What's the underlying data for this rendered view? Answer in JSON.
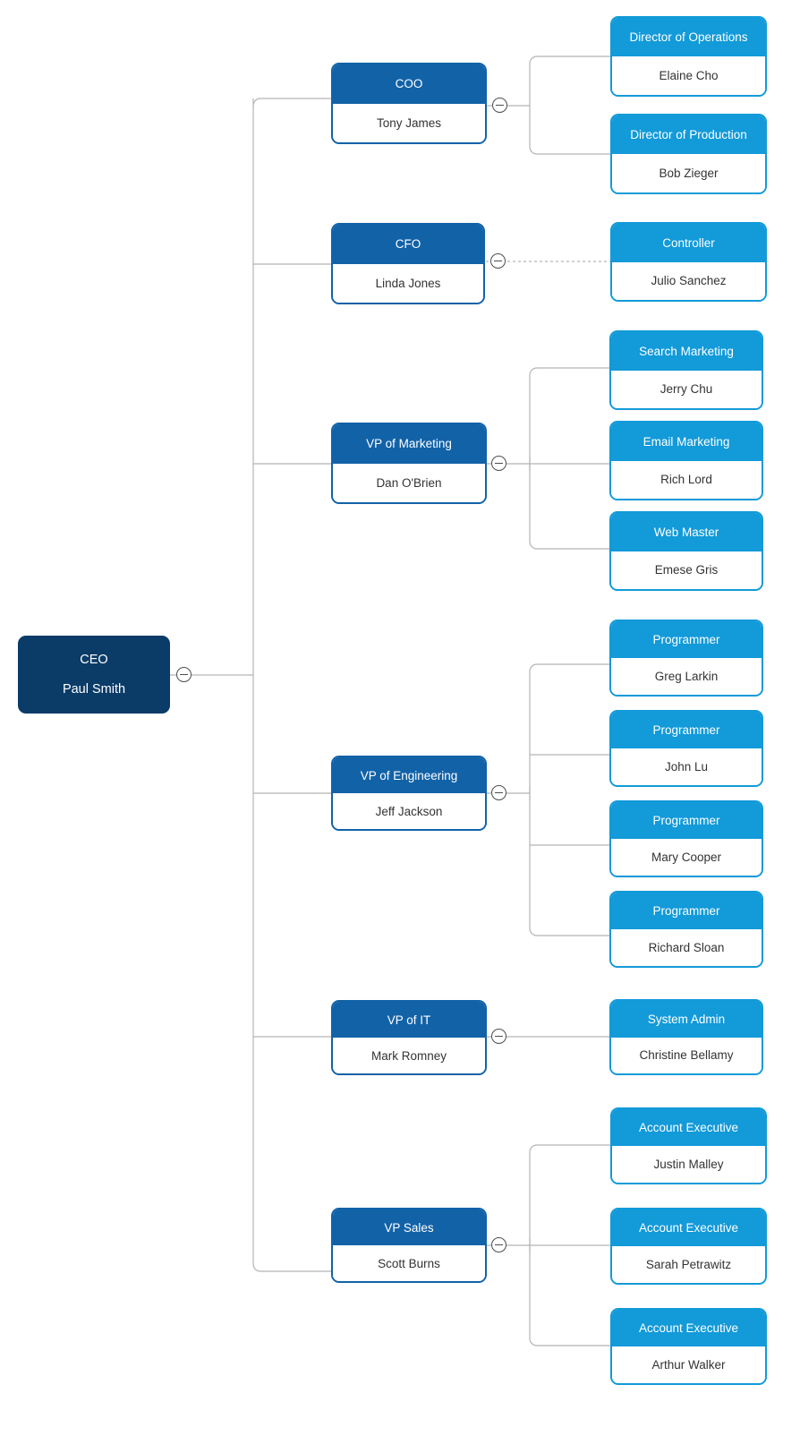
{
  "chart": {
    "type": "org-chart",
    "orientation": "horizontal-left-to-right",
    "colors": {
      "root_fill": "#0b3c68",
      "level2_fill": "#1262a8",
      "level3_fill": "#129ad9",
      "connector": "#b3b3b3",
      "node_body": "#ffffff",
      "name_text": "#333333",
      "title_text": "#ffffff"
    },
    "toggle_icon": "minus-circle-icon"
  },
  "nodes": {
    "ceo": {
      "title": "CEO",
      "name": "Paul Smith"
    },
    "coo": {
      "title": "COO",
      "name": "Tony James"
    },
    "cfo": {
      "title": "CFO",
      "name": "Linda Jones"
    },
    "vp_marketing": {
      "title": "VP of Marketing",
      "name": "Dan O'Brien"
    },
    "vp_engineering": {
      "title": "VP of Engineering",
      "name": "Jeff Jackson"
    },
    "vp_it": {
      "title": "VP of IT",
      "name": "Mark Romney"
    },
    "vp_sales": {
      "title": "VP Sales",
      "name": "Scott Burns"
    },
    "dir_operations": {
      "title": "Director of Operations",
      "name": "Elaine Cho"
    },
    "dir_production": {
      "title": "Director of Production",
      "name": "Bob Zieger"
    },
    "controller": {
      "title": "Controller",
      "name": "Julio Sanchez"
    },
    "search_marketing": {
      "title": "Search Marketing",
      "name": "Jerry Chu"
    },
    "email_marketing": {
      "title": "Email Marketing",
      "name": "Rich Lord"
    },
    "web_master": {
      "title": "Web Master",
      "name": "Emese Gris"
    },
    "programmer_1": {
      "title": "Programmer",
      "name": "Greg Larkin"
    },
    "programmer_2": {
      "title": "Programmer",
      "name": "John Lu"
    },
    "programmer_3": {
      "title": "Programmer",
      "name": "Mary Cooper"
    },
    "programmer_4": {
      "title": "Programmer",
      "name": "Richard Sloan"
    },
    "system_admin": {
      "title": "System Admin",
      "name": "Christine Bellamy"
    },
    "account_exec_1": {
      "title": "Account Executive",
      "name": "Justin Malley"
    },
    "account_exec_2": {
      "title": "Account Executive",
      "name": "Sarah Petrawitz"
    },
    "account_exec_3": {
      "title": "Account Executive",
      "name": "Arthur Walker"
    }
  },
  "chart_data": {
    "type": "tree",
    "root": "ceo",
    "edges": [
      {
        "from": "ceo",
        "to": "coo",
        "style": "solid"
      },
      {
        "from": "ceo",
        "to": "cfo",
        "style": "solid"
      },
      {
        "from": "ceo",
        "to": "vp_marketing",
        "style": "solid"
      },
      {
        "from": "ceo",
        "to": "vp_engineering",
        "style": "solid"
      },
      {
        "from": "ceo",
        "to": "vp_it",
        "style": "solid"
      },
      {
        "from": "ceo",
        "to": "vp_sales",
        "style": "solid"
      },
      {
        "from": "coo",
        "to": "dir_operations",
        "style": "solid"
      },
      {
        "from": "coo",
        "to": "dir_production",
        "style": "solid"
      },
      {
        "from": "cfo",
        "to": "controller",
        "style": "dashed"
      },
      {
        "from": "vp_marketing",
        "to": "search_marketing",
        "style": "solid"
      },
      {
        "from": "vp_marketing",
        "to": "email_marketing",
        "style": "solid"
      },
      {
        "from": "vp_marketing",
        "to": "web_master",
        "style": "solid"
      },
      {
        "from": "vp_engineering",
        "to": "programmer_1",
        "style": "solid"
      },
      {
        "from": "vp_engineering",
        "to": "programmer_2",
        "style": "solid"
      },
      {
        "from": "vp_engineering",
        "to": "programmer_3",
        "style": "solid"
      },
      {
        "from": "vp_engineering",
        "to": "programmer_4",
        "style": "solid"
      },
      {
        "from": "vp_it",
        "to": "system_admin",
        "style": "solid"
      },
      {
        "from": "vp_sales",
        "to": "account_exec_1",
        "style": "solid"
      },
      {
        "from": "vp_sales",
        "to": "account_exec_2",
        "style": "solid"
      },
      {
        "from": "vp_sales",
        "to": "account_exec_3",
        "style": "solid"
      }
    ],
    "levels": {
      "1": [
        "ceo"
      ],
      "2": [
        "coo",
        "cfo",
        "vp_marketing",
        "vp_engineering",
        "vp_it",
        "vp_sales"
      ],
      "3": [
        "dir_operations",
        "dir_production",
        "controller",
        "search_marketing",
        "email_marketing",
        "web_master",
        "programmer_1",
        "programmer_2",
        "programmer_3",
        "programmer_4",
        "system_admin",
        "account_exec_1",
        "account_exec_2",
        "account_exec_3"
      ]
    }
  }
}
